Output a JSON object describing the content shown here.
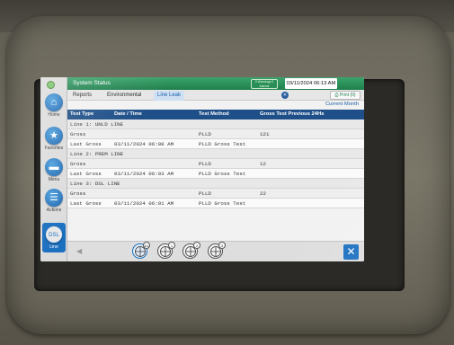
{
  "nav": {
    "home": "Home",
    "favorites": "Favorites",
    "menu": "Menu",
    "actions": "Actions",
    "line": "Line",
    "line_icon_text": "DSL"
  },
  "titlebar": {
    "title": "System Status",
    "alarm_badge": "0 Warnings 0 Alarms",
    "datetime": "03/11/2024 06:13 AM"
  },
  "tabs": {
    "items": [
      "Reports",
      "Environmental",
      "Line Leak"
    ],
    "active": "Line Leak",
    "print_label": "Print (0)"
  },
  "subheader": "Current Month",
  "table": {
    "headers": [
      "Test Type",
      "Date / Time",
      "Test Method",
      "Gross Test Previous 24Hs"
    ],
    "groups": [
      {
        "name": "Line 1: UNLD LINE",
        "rows": [
          {
            "type": "Gross",
            "date": "",
            "method": "PLLD",
            "result": "121"
          },
          {
            "type": "Last Gross",
            "date": "03/11/2024 06:08 AM",
            "method": "PLLD Gross Test",
            "result": ""
          }
        ]
      },
      {
        "name": "Line 2: PREM LINE",
        "rows": [
          {
            "type": "Gross",
            "date": "",
            "method": "PLLD",
            "result": "12"
          },
          {
            "type": "Last Gross",
            "date": "03/11/2024 06:03 AM",
            "method": "PLLD Gross Test",
            "result": ""
          }
        ]
      },
      {
        "name": "Line 3: DSL LINE",
        "rows": [
          {
            "type": "Gross",
            "date": "",
            "method": "PLLD",
            "result": "22"
          },
          {
            "type": "Last Gross",
            "date": "03/11/2024 06:01 AM",
            "method": "PLLD Gross Test",
            "result": ""
          }
        ]
      }
    ]
  },
  "bottombar": {
    "line_badges": [
      "A1",
      "1",
      "2",
      "3"
    ],
    "close_symbol": "✕"
  },
  "colors": {
    "title_green": "#1f7f4c",
    "header_blue": "#1e4f88",
    "accent_blue": "#1c70c0"
  }
}
